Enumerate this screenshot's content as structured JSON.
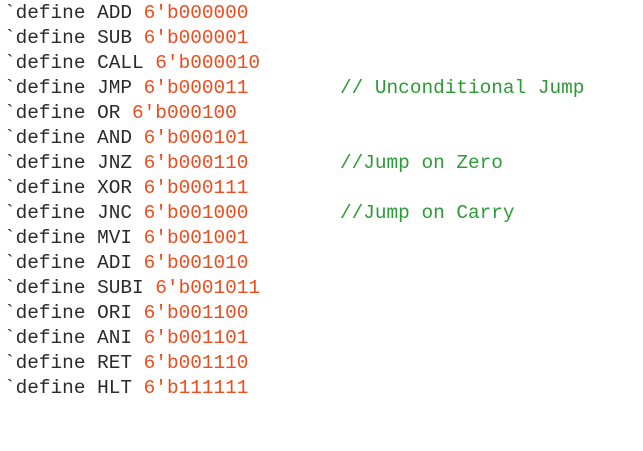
{
  "colors": {
    "text": "#2a2a2a",
    "number": "#ef4c1e",
    "comment": "#2c9b35",
    "background": "#ffffff"
  },
  "code": {
    "lines": [
      {
        "directive": "`define",
        "name": "ADD",
        "value": "6'b000000",
        "comment": ""
      },
      {
        "directive": "`define",
        "name": "SUB",
        "value": "6'b000001",
        "comment": ""
      },
      {
        "directive": "`define",
        "name": "CALL",
        "value": "6'b000010",
        "comment": ""
      },
      {
        "directive": "`define",
        "name": "JMP",
        "value": "6'b000011",
        "comment": "// Unconditional Jump"
      },
      {
        "directive": "`define",
        "name": "OR",
        "value": "6'b000100",
        "comment": ""
      },
      {
        "directive": "`define",
        "name": "AND",
        "value": "6'b000101",
        "comment": ""
      },
      {
        "directive": "`define",
        "name": "JNZ",
        "value": "6'b000110",
        "comment": "//Jump on Zero"
      },
      {
        "directive": "`define",
        "name": "XOR",
        "value": "6'b000111",
        "comment": ""
      },
      {
        "directive": "`define",
        "name": "JNC",
        "value": "6'b001000",
        "comment": "//Jump on Carry"
      },
      {
        "directive": "`define",
        "name": "MVI",
        "value": "6'b001001",
        "comment": ""
      },
      {
        "directive": "`define",
        "name": "ADI",
        "value": "6'b001010",
        "comment": ""
      },
      {
        "directive": "`define",
        "name": "SUBI",
        "value": "6'b001011",
        "comment": ""
      },
      {
        "directive": "`define",
        "name": "ORI",
        "value": "6'b001100",
        "comment": ""
      },
      {
        "directive": "`define",
        "name": "ANI",
        "value": "6'b001101",
        "comment": ""
      },
      {
        "directive": "`define",
        "name": "RET",
        "value": "6'b001110",
        "comment": ""
      },
      {
        "directive": "`define",
        "name": "HLT",
        "value": "6'b111111",
        "comment": ""
      }
    ]
  }
}
